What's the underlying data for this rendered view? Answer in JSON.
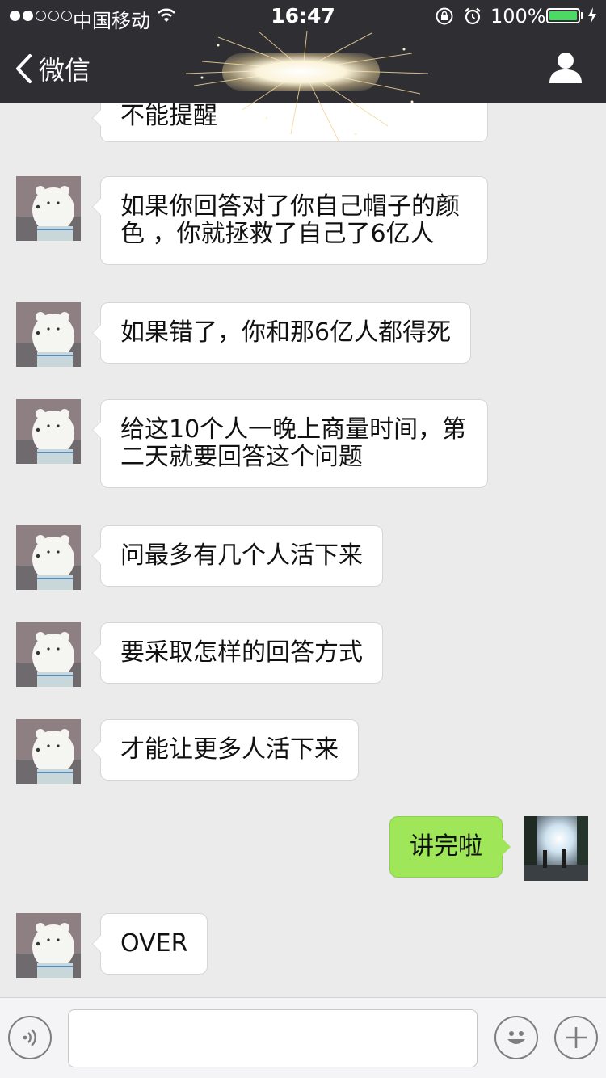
{
  "status_bar": {
    "carrier": "中国移动",
    "time": "16:47",
    "battery": "100%",
    "battery_level": 1.0,
    "signal_bars_filled": 2,
    "signal_bars_total": 5
  },
  "nav": {
    "back_label": "微信",
    "title": ""
  },
  "messages": [
    {
      "side": "left",
      "text": "不能提醒"
    },
    {
      "side": "left",
      "text": "如果你回答对了你自己帽子的颜色 ，你就拯救了自己了6亿人"
    },
    {
      "side": "left",
      "text": "如果错了，你和那6亿人都得死"
    },
    {
      "side": "left",
      "text": "给这10个人一晚上商量时间，第二天就要回答这个问题"
    },
    {
      "side": "left",
      "text": "问最多有几个人活下来"
    },
    {
      "side": "left",
      "text": "要采取怎样的回答方式"
    },
    {
      "side": "left",
      "text": "才能让更多人活下来"
    },
    {
      "side": "right",
      "text": "讲完啦"
    },
    {
      "side": "left",
      "text": "OVER"
    }
  ],
  "input_bar": {
    "value": "",
    "placeholder": ""
  },
  "colors": {
    "nav_bg": "#2e2e33",
    "chat_bg": "#ebebeb",
    "self_bubble": "#9fe658",
    "other_bubble": "#ffffff",
    "battery_fill": "#4cd964"
  }
}
